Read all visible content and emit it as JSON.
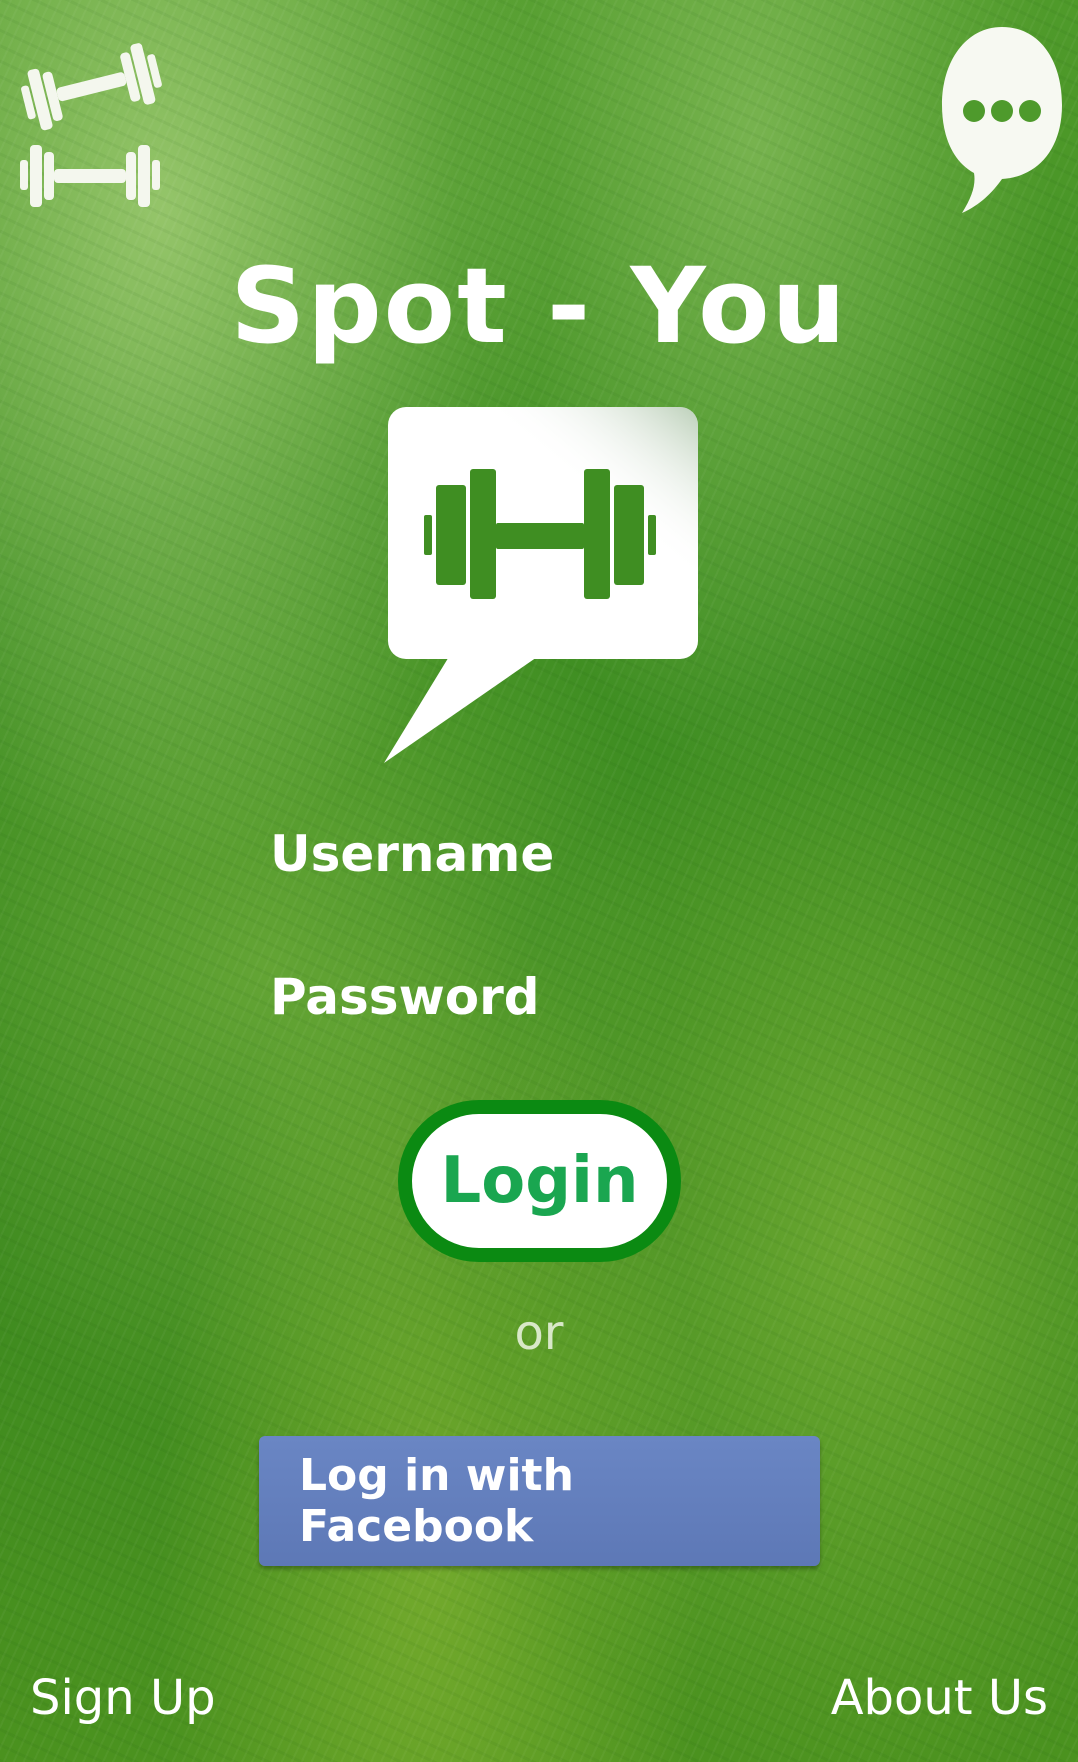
{
  "app": {
    "title": "Spot - You"
  },
  "login_form": {
    "username_label": "Username",
    "password_label": "Password",
    "login_button": "Login",
    "separator": "or",
    "facebook_button": "Log in with Facebook"
  },
  "footer": {
    "sign_up": "Sign Up",
    "about_us": "About Us"
  },
  "colors": {
    "background_green": "#3f8e22",
    "login_border": "#0b8a12",
    "login_text": "#1aa650",
    "facebook_blue": "#6a86c4"
  },
  "icons": {
    "top_left": "dumbbells-icon",
    "top_right": "chat-bubble-icon",
    "logo": "dumbbell-chat-logo"
  }
}
